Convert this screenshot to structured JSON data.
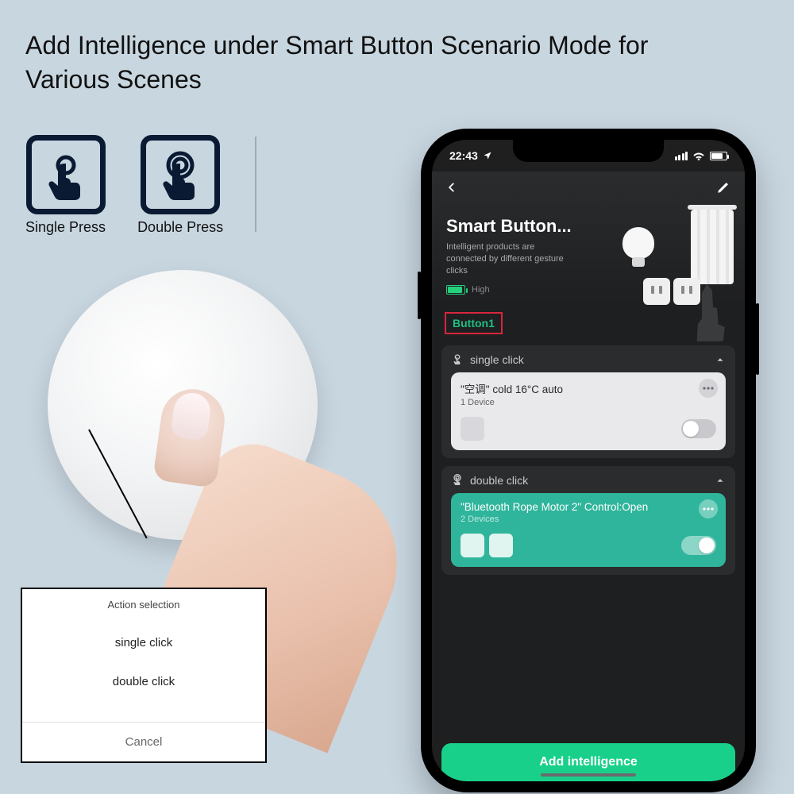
{
  "marketing": {
    "title": "Add Intelligence under Smart Button Scenario Mode for Various Scenes"
  },
  "press_icons": {
    "single": "Single Press",
    "double": "Double Press"
  },
  "action_sheet": {
    "title": "Action selection",
    "option_single": "single click",
    "option_double": "double click",
    "cancel": "Cancel"
  },
  "phone": {
    "status": {
      "time": "22:43"
    },
    "hero": {
      "title": "Smart Button...",
      "subtitle": "Intelligent products are connected by different gesture clicks",
      "battery_label": "High"
    },
    "tabs": {
      "active": "Button1"
    },
    "sections": {
      "single": {
        "label": "single click",
        "card": {
          "title": "\"空调\" cold 16°C auto",
          "subtitle": "1 Device"
        }
      },
      "double": {
        "label": "double click",
        "card": {
          "title": "\"Bluetooth Rope Motor 2\" Control:Open",
          "subtitle": "2 Devices"
        }
      }
    },
    "cta": "Add intelligence"
  }
}
